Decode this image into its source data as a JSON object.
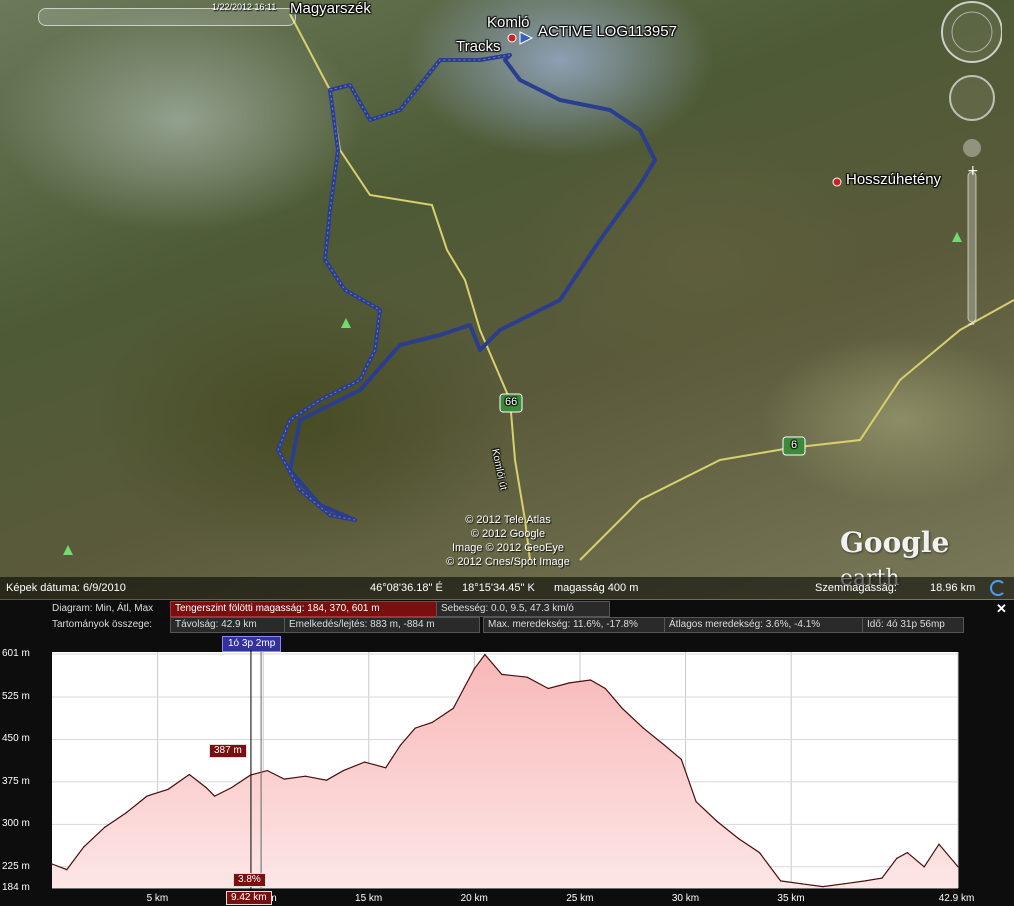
{
  "map": {
    "timeslider_date": "1/22/2012 16:11",
    "places": {
      "magyarszek": "Magyarszék",
      "komlo": "Komló",
      "hosszuheteny": "Hosszúhetény",
      "road_name": "Komlói út"
    },
    "track_labels": {
      "tracks": "Tracks",
      "active_log": "ACTIVE LOG113957"
    },
    "road_shields": {
      "r66": "66",
      "r6": "6"
    },
    "copyright": [
      "© 2012 Tele Atlas",
      "© 2012 Google",
      "Image © 2012 GeoEye",
      "© 2012 Cnes/Spot Image"
    ],
    "logo": {
      "google": "Google",
      "earth": "earth"
    },
    "icons": [
      "compass-icon",
      "look-joystick-icon",
      "pegman-icon",
      "zoom-slider-icon"
    ],
    "colors": {
      "track": "#2b3d8f",
      "road": "#d8d070"
    }
  },
  "statusbar": {
    "image_date": "Képek dátuma: 6/9/2010",
    "coords": "46°08'36.18\" É",
    "coords2": "18°15'34.45\" K",
    "altitude": "magasság   400 m",
    "eye_alt_label": "Szemmagasság:",
    "eye_alt_value": "18.96 km"
  },
  "profile": {
    "row1": {
      "diagram": "Diagram: Min, Átl, Max",
      "elevation": "Tengerszint fölötti magasság: 184, 370, 601 m",
      "speed": "Sebesség: 0.0, 9.5, 47.3 km/ó"
    },
    "row2": {
      "ranges": "Tartományok összege:",
      "distance": "Távolság: 42.9 km",
      "gain": "Emelkedés/lejtés: 883 m, -884 m",
      "max_grade": "Max. meredekség: 11.6%, -17.8%",
      "avg_grade": "Átlagos meredekség: 3.6%, -4.1%",
      "time": "Idő: 4ó 31p 56mp"
    },
    "cursor_time": "1ó 3p 2mp",
    "cursor_elev": "387 m",
    "cursor_grade": "3.8%",
    "cursor_dist": "9.42 km",
    "close_icon": "close-icon"
  },
  "chart_data": {
    "type": "area",
    "xlabel": "",
    "ylabel": "",
    "xlim": [
      0,
      42.9
    ],
    "ylim": [
      184,
      601
    ],
    "x_ticks": [
      "5 km",
      "10 km",
      "15 km",
      "20 km",
      "25 km",
      "30 km",
      "35 km",
      "42.9 km"
    ],
    "y_ticks": [
      "601 m",
      "525 m",
      "450 m",
      "375 m",
      "300 m",
      "225 m",
      "184 m"
    ],
    "x": [
      0,
      0.7,
      1.5,
      2.5,
      3.5,
      4.5,
      5.5,
      6.5,
      7.3,
      7.7,
      8.5,
      9.4,
      10.2,
      11,
      12,
      13,
      13.8,
      14.8,
      15.8,
      16.5,
      17.2,
      18,
      19,
      19.5,
      20,
      20.5,
      21.3,
      22.5,
      23.5,
      24.5,
      25.5,
      26.2,
      27,
      28,
      29,
      29.8,
      30.5,
      31.5,
      32.5,
      33.5,
      34.5,
      35.5,
      36.5,
      37.5,
      38.5,
      39.3,
      40,
      40.5,
      41.3,
      42,
      42.9
    ],
    "elev_m": [
      230,
      220,
      260,
      295,
      320,
      350,
      362,
      388,
      365,
      350,
      365,
      387,
      395,
      380,
      385,
      378,
      395,
      410,
      400,
      440,
      470,
      480,
      505,
      540,
      575,
      600,
      565,
      560,
      540,
      550,
      555,
      540,
      505,
      470,
      440,
      415,
      340,
      305,
      275,
      250,
      200,
      195,
      190,
      195,
      200,
      205,
      240,
      250,
      225,
      265,
      225
    ]
  }
}
